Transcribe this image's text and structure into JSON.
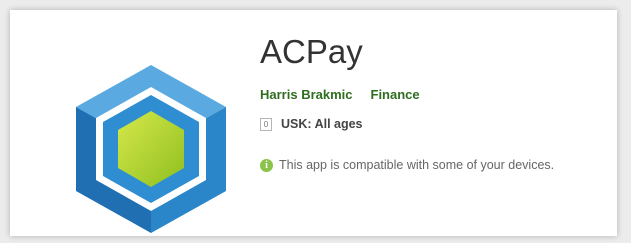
{
  "app": {
    "title": "ACPay",
    "developer": "Harris Brakmic",
    "category": "Finance",
    "rating_badge": "0",
    "rating_text": "USK: All ages",
    "compat_text": "This app is compatible with some of your devices.",
    "icon": "cube-logo-icon"
  },
  "colors": {
    "link_green": "#2f6e1f",
    "info_green": "#8bc34a",
    "cube_blue": "#2e8fcf",
    "cube_core": "#b6d52b"
  }
}
